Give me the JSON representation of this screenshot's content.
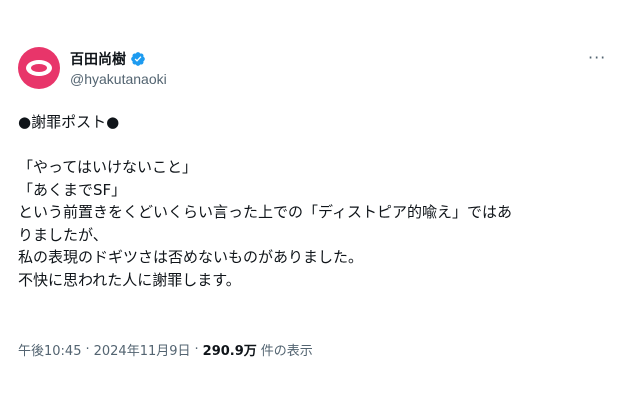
{
  "colors": {
    "avatar": "#e8356a",
    "verified": "#1d9bf0",
    "text": "#0f1419",
    "secondary": "#536471"
  },
  "author": {
    "display_name": "百田尚樹",
    "handle": "@hyakutanaoki",
    "verified_icon": "verified-badge-icon",
    "avatar_icon": "avatar"
  },
  "more_icon": "more-icon",
  "more_label": "···",
  "tweet": {
    "lines": [
      "●謝罪ポスト●",
      "",
      "「やってはいけないこと」",
      "「あくまでSF」",
      "という前置きをくどいくらい言った上での「ディストピア的喩え」ではあ",
      "りましたが、",
      "私の表現のドギツさは否めないものがありました。",
      "不快に思われた人に謝罪します。"
    ]
  },
  "meta": {
    "time": "午後10:45",
    "date": "2024年11月9日",
    "separator": "·",
    "views_count": "290.9万",
    "views_label": "件の表示"
  }
}
